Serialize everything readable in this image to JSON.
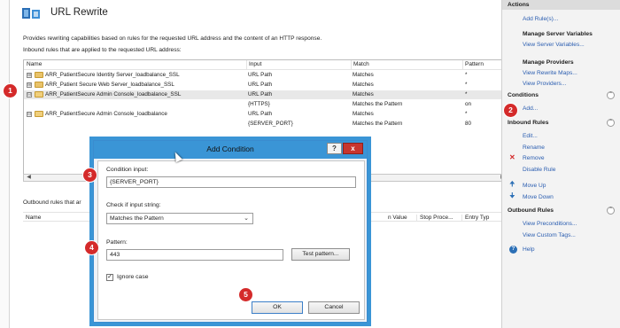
{
  "header": {
    "title": "URL Rewrite",
    "description": "Provides rewriting capabilities based on rules for the requested URL address and the content of an HTTP response.",
    "inbound_label": "Inbound rules that are applied to the requested URL address:"
  },
  "inbound_table": {
    "columns": [
      "Name",
      "Input",
      "Match",
      "Pattern"
    ],
    "rows": [
      {
        "expander": "⊞",
        "name": "ARR_PatientSecure Identity Server_loadbalance_SSL",
        "input": "URL Path",
        "match": "Matches",
        "pattern": "*"
      },
      {
        "expander": "⊞",
        "name": "ARR_Patient Secure Web Server_loadbalance_SSL",
        "input": "URL Path",
        "match": "Matches",
        "pattern": "*"
      },
      {
        "expander": "⊟",
        "name": "ARR_PatientSecure Admin Console_loadbalance_SSL",
        "input": "URL Path",
        "match": "Matches",
        "pattern": "*"
      },
      {
        "expander": "",
        "name": "",
        "input": "{HTTPS}",
        "match": "Matches the Pattern",
        "pattern": "on"
      },
      {
        "expander": "⊟",
        "name": "ARR_PatientSecure Admin Console_loadbalance",
        "input": "URL Path",
        "match": "Matches",
        "pattern": "*"
      },
      {
        "expander": "",
        "name": "",
        "input": "{SERVER_PORT}",
        "match": "Matches the Pattern",
        "pattern": "80"
      }
    ]
  },
  "outbound": {
    "label": "Outbound rules that ar",
    "columns": [
      "Name",
      "n Value",
      "Stop Proce...",
      "Entry Typ"
    ]
  },
  "actions": {
    "header": "Actions",
    "add_rules": "Add Rule(s)...",
    "manage_server_vars_title": "Manage Server Variables",
    "view_server_vars": "View Server Variables...",
    "manage_providers_title": "Manage Providers",
    "view_rewrite_maps": "View Rewrite Maps...",
    "view_providers": "View Providers...",
    "conditions_title": "Conditions",
    "add": "Add...",
    "inbound_rules_title": "Inbound Rules",
    "edit": "Edit...",
    "rename": "Rename",
    "remove": "Remove",
    "disable_rule": "Disable Rule",
    "move_up": "Move Up",
    "move_down": "Move Down",
    "outbound_rules_title": "Outbound Rules",
    "view_preconditions": "View Preconditions...",
    "view_custom_tags": "View Custom Tags...",
    "help": "Help"
  },
  "dialog": {
    "title": "Add Condition",
    "help_btn": "?",
    "close_btn": "x",
    "condition_input_label": "Condition input:",
    "condition_input_value": "{SERVER_PORT}",
    "check_label": "Check if input string:",
    "check_value": "Matches the Pattern",
    "pattern_label": "Pattern:",
    "pattern_value": "443",
    "test_pattern": "Test pattern...",
    "ignore_case_label": "Ignore case",
    "ignore_case_checked": "✓",
    "ok": "OK",
    "cancel": "Cancel"
  },
  "callouts": [
    "1",
    "2",
    "3",
    "4",
    "5"
  ],
  "colors": {
    "accent_blue": "#3a95d6",
    "link_blue": "#2a5db0",
    "badge_red": "#d42a2a",
    "close_red": "#c7352e",
    "folder_yellow": "#e9c36a"
  }
}
